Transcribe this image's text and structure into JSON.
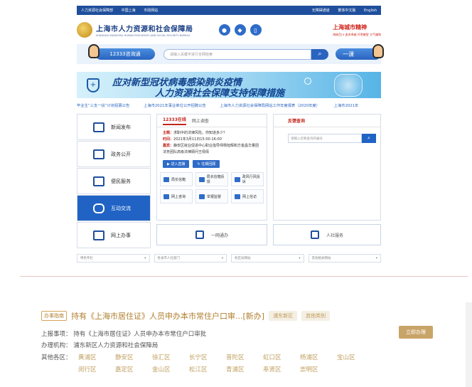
{
  "topbar": {
    "left": [
      "人力资源社会保障部",
      "中国上海",
      "市政网站"
    ],
    "right": [
      "无障碍通道",
      "繁体中文版",
      "English"
    ]
  },
  "header": {
    "title": "上海市人力资源和社会保障局",
    "title_en": "SHANGHAI MUNICIPAL HUMAN RESOURCES AND SOCIAL SECURITY BUREAU",
    "slogan": "上海城市精神",
    "slogan_sub": "海纳百川  追求卓越  开明睿智  大气谦和",
    "icons": [
      "weibo-icon",
      "wechat-icon",
      "mobile-icon"
    ]
  },
  "search": {
    "hotline_label": "12333咨询通",
    "placeholder": "请输入关键字进行全网检索",
    "button_icon": "search-icon",
    "yiwang_label": "一课"
  },
  "banner": {
    "line1": "应对新型冠状病毒感染肺炎疫情",
    "line2": "人力资源社会保障支持保障措施"
  },
  "ticker": [
    "毕业生“三支一扶”计划招募公告",
    "上海市2021年事业单位公开招聘公告",
    "上海市人力资源社会保障局网站工作年度报表（2020年度）",
    "上海市2021年"
  ],
  "left_menu": [
    {
      "label": "新闻发布",
      "icon": "newspaper-icon",
      "active": false
    },
    {
      "label": "政务公开",
      "icon": "document-icon",
      "active": false
    },
    {
      "label": "便民服务",
      "icon": "people-icon",
      "active": false
    },
    {
      "label": "互动交流",
      "icon": "chat-icon",
      "active": true
    },
    {
      "label": "网上办事",
      "icon": "monitor-icon",
      "active": false
    }
  ],
  "center": {
    "tab_active": "12333在线",
    "tab_other": "网上调查",
    "topic_label": "主题：",
    "topic": "求职中的法律风险，你知道多少？",
    "time_label": "时间：",
    "time": "2021年3月11日15:00-16:00",
    "guest_label": "嘉宾：",
    "guest": "静安区就业促进中心职业指导师杨旭辉和方金昌华量团法务团队高级法律顾问王倩倩",
    "btn_enter": "进入直播",
    "btn_past": "往期回顾",
    "cells": [
      {
        "label": "局长信箱",
        "icon": "mail-icon"
      },
      {
        "label": "局长信箱反馈",
        "icon": "mailbox-icon"
      },
      {
        "label": "政风行风投诉",
        "icon": "users-icon"
      },
      {
        "label": "网上咨询",
        "icon": "bubble-icon"
      },
      {
        "label": "举报监督",
        "icon": "phone-icon"
      },
      {
        "label": "网上信访",
        "icon": "screen-icon"
      }
    ]
  },
  "right": {
    "title": "反馈查询",
    "placeholder": "请输入您要查询的编号",
    "button_icon": "search-icon"
  },
  "bottom_links": [
    {
      "label": "一网通办",
      "icon": "edit-icon"
    },
    {
      "label": "人社服务",
      "icon": "monitor-icon"
    }
  ],
  "selects": [
    "特色专栏",
    "各省市人社部门",
    "各区局网站",
    "其他相关网站"
  ],
  "service": {
    "tag": "办事指南",
    "title": "持有《上海市居住证》人员申办本市常住户口审...[新办]",
    "badges": [
      "浦东新区",
      "其他类别"
    ],
    "item_label": "上报事项：",
    "item_value": "持有《上海市居住证》人员申办本市常住户口审批",
    "org_label": "办理机构：",
    "org_value": "浦东新区人力资源和社会保障局",
    "other_label": "其他各区：",
    "apply": "立即办理",
    "districts_row1": [
      "黄浦区",
      "静安区",
      "徐汇区",
      "长宁区",
      "普陀区",
      "虹口区",
      "杨浦区",
      "宝山区"
    ],
    "districts_row2": [
      "闵行区",
      "嘉定区",
      "金山区",
      "松江区",
      "青浦区",
      "奉贤区",
      "崇明区"
    ]
  },
  "colors": {
    "primary": "#1f4f9c",
    "accent": "#c0261c",
    "gold": "#c9a468"
  }
}
